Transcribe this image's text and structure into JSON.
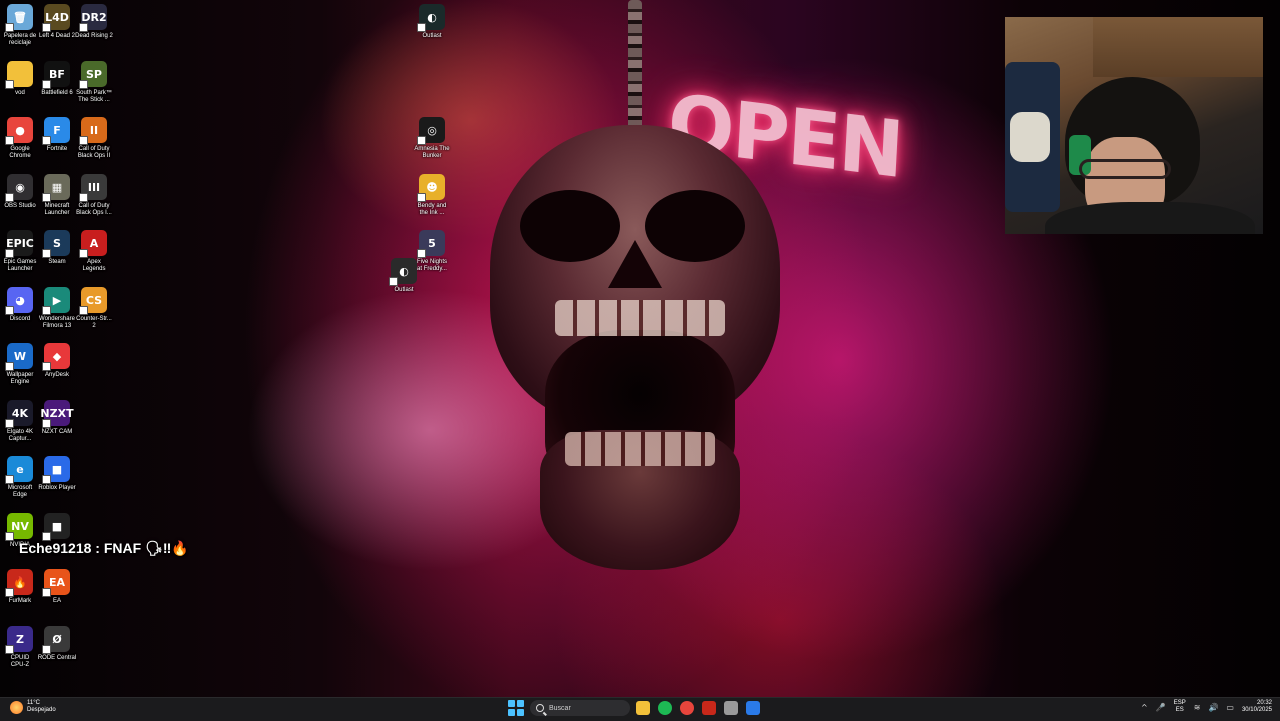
{
  "desktop": {
    "icons": [
      {
        "label": "Papelera de\nreciclaje",
        "glyph": "🗑",
        "color": "#6aa8d8"
      },
      {
        "label": "Left 4 Dead 2",
        "glyph": "L4D",
        "color": "#5a4a20"
      },
      {
        "label": "Dead Rising 2",
        "glyph": "DR2",
        "color": "#2a2a40"
      },
      {
        "label": "vod",
        "glyph": "",
        "color": "#f2c03a"
      },
      {
        "label": "Battlefield 6",
        "glyph": "BF",
        "color": "#111111"
      },
      {
        "label": "South Park™\nThe Stick ...",
        "glyph": "SP",
        "color": "#4a6a2a"
      },
      {
        "label": "Google\nChrome",
        "glyph": "●",
        "color": "#e8453c"
      },
      {
        "label": "Fortnite",
        "glyph": "F",
        "color": "#2a8ae8"
      },
      {
        "label": "Call of Duty\nBlack Ops II",
        "glyph": "II",
        "color": "#d86a1a"
      },
      {
        "label": "OBS Studio",
        "glyph": "◉",
        "color": "#302e31"
      },
      {
        "label": "Minecraft\nLauncher",
        "glyph": "▦",
        "color": "#6a6a5a"
      },
      {
        "label": "Call of Duty\nBlack Ops I...",
        "glyph": "III",
        "color": "#3a3a3a"
      },
      {
        "label": "Epic Games\nLauncher",
        "glyph": "EPIC",
        "color": "#1a1a1a"
      },
      {
        "label": "Steam",
        "glyph": "S",
        "color": "#1b3a5a"
      },
      {
        "label": "Apex\nLegends",
        "glyph": "A",
        "color": "#c81e1e"
      },
      {
        "label": "Discord",
        "glyph": "◕",
        "color": "#5865f2"
      },
      {
        "label": "Wondershare\nFilmora 13",
        "glyph": "▶",
        "color": "#1a8a7a"
      },
      {
        "label": "Counter-Str...\n2",
        "glyph": "CS",
        "color": "#e89a2a"
      },
      {
        "label": "Wallpaper\nEngine",
        "glyph": "W",
        "color": "#1a6ac8"
      },
      {
        "label": "AnyDesk",
        "glyph": "◆",
        "color": "#e8383a"
      },
      {
        "label": "Elgato 4K\nCaptur...",
        "glyph": "4K",
        "color": "#1a1a2a"
      },
      {
        "label": "NZXT CAM",
        "glyph": "NZXT",
        "color": "#4a1a7a"
      },
      {
        "label": "Microsoft\nEdge",
        "glyph": "e",
        "color": "#1a8ad8"
      },
      {
        "label": "Roblox Player",
        "glyph": "■",
        "color": "#2a6ae8"
      },
      {
        "label": "NVIDIA",
        "glyph": "NV",
        "color": "#76b900"
      },
      {
        "label": "",
        "glyph": "■",
        "color": "#222222"
      },
      {
        "label": "FurMark",
        "glyph": "🔥",
        "color": "#c8281a"
      },
      {
        "label": "EA",
        "glyph": "EA",
        "color": "#e8541a"
      },
      {
        "label": "CPUID\nCPU-Z",
        "glyph": "Z",
        "color": "#3a2a8a"
      },
      {
        "label": "RODE Central",
        "glyph": "Ø",
        "color": "#3a3a3a"
      },
      {
        "label": "Outlast",
        "glyph": "◐",
        "color": "#1a2a2a"
      },
      {
        "label": "Amnesia The\nBunker",
        "glyph": "◎",
        "color": "#1a1a1a"
      },
      {
        "label": "Bendy and\nthe Ink ...",
        "glyph": "☻",
        "color": "#e8b02a"
      },
      {
        "label": "Five Nights\nat Freddy...",
        "glyph": "5",
        "color": "#3a3a5a"
      },
      {
        "label": "Outlast",
        "glyph": "◐",
        "color": "#2a2a2a"
      }
    ]
  },
  "wallpaper": {
    "neon_text": "OPEN"
  },
  "chat": {
    "message": "Eche91218 : FNAF 🗣‼🔥"
  },
  "taskbar": {
    "weather_temp": "11°C",
    "weather_desc": "Despejado",
    "search_placeholder": "Buscar",
    "apps": [
      "#f2c03a",
      "#1db954",
      "#e8453c",
      "#c8281a",
      "#9a9a9a",
      "#2a7ae8"
    ],
    "tray_chevron": "^",
    "lang_top": "ESP",
    "lang_bottom": "ES",
    "time": "20:32",
    "date": "30/10/2025"
  }
}
